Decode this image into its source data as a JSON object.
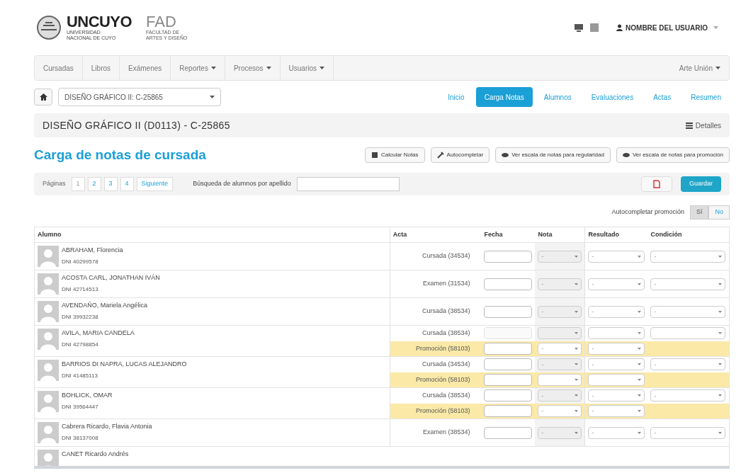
{
  "header": {
    "logo": {
      "name": "UNCUYO",
      "subtitle": "UNIVERSIDAD NACIONAL DE CUYO"
    },
    "faculty": {
      "name": "FAD",
      "subtitle": "FACULTAD DE ARTES Y DISEÑO"
    },
    "user": "NOMBRE DEL USUARIO"
  },
  "nav": {
    "items": [
      {
        "label": "Cursadas",
        "dropdown": false
      },
      {
        "label": "Libros",
        "dropdown": false
      },
      {
        "label": "Exámenes",
        "dropdown": false
      },
      {
        "label": "Reportes",
        "dropdown": true
      },
      {
        "label": "Procesos",
        "dropdown": true
      },
      {
        "label": "Usuarios",
        "dropdown": true
      }
    ],
    "right": {
      "label": "Arte Unión",
      "dropdown": true
    }
  },
  "course_select": {
    "value": "DISEÑO GRÁFICO II: C-25865"
  },
  "tabs": [
    {
      "label": "Inicio",
      "selected": false
    },
    {
      "label": "Carga Notas",
      "selected": true
    },
    {
      "label": "Alumnos",
      "selected": false
    },
    {
      "label": "Evaluaciones",
      "selected": false
    },
    {
      "label": "Actas",
      "selected": false
    },
    {
      "label": "Resumen",
      "selected": false
    }
  ],
  "course_title": "DISEÑO GRÁFICO II (D0113) - C-25865",
  "details_link": "Detalles",
  "page_title": "Carga de notas de cursada",
  "actions": [
    "Calcular Notas",
    "Autocompletar",
    "Ver escala de notas para regularidad",
    "Ver escala de notas para promoción"
  ],
  "pagination": {
    "label": "Páginas",
    "pages": [
      {
        "label": "1",
        "selected": true
      },
      {
        "label": "2",
        "selected": false
      },
      {
        "label": "3",
        "selected": false
      },
      {
        "label": "4",
        "selected": false
      }
    ],
    "next": "Siguiente"
  },
  "search": {
    "label": "Búsqueda de alumnos por apellido"
  },
  "save_button": "Guardar",
  "autocomplete": {
    "label": "Autocompletar promoción",
    "options": [
      {
        "label": "Sí",
        "selected": true
      },
      {
        "label": "No",
        "selected": false
      }
    ]
  },
  "table": {
    "columns": [
      "Alumno",
      "Acta",
      "Fecha",
      "Nota",
      "Resultado",
      "Condición"
    ],
    "rows": [
      {
        "name": "ABRAHAM, Florencia",
        "id": "DNI 40299578",
        "actas": [
          {
            "kind": "cursada",
            "label": "Cursada (34534)",
            "disabled": false,
            "nota": "-",
            "resultado": "-",
            "condicion": "-"
          }
        ]
      },
      {
        "name": "ACOSTA CARL, JONATHAN IVÁN",
        "id": "DNI 42714513",
        "actas": [
          {
            "kind": "cursada",
            "label": "Examen (31534)",
            "disabled": false,
            "nota": "-",
            "resultado": "-",
            "condicion": "-"
          }
        ]
      },
      {
        "name": "AVENDAÑO, Mariela Angélica",
        "id": "DNI 39932238",
        "actas": [
          {
            "kind": "cursada",
            "label": "Cursada (38534)",
            "disabled": false,
            "nota": "-",
            "resultado": "-",
            "condicion": "-"
          }
        ]
      },
      {
        "name": "AVILA, MARIA CANDELA",
        "id": "DNI 42798854",
        "actas": [
          {
            "kind": "cursada",
            "label": "Cursada (38534)",
            "disabled": true
          },
          {
            "kind": "promocion",
            "label": "Promoción (58103)",
            "disabled": false,
            "nota": "-",
            "resultado": "-"
          }
        ]
      },
      {
        "name": "BARRIOS DI NAPRA, LUCAS ALEJANDRO",
        "id": "DNI 41485113",
        "actas": [
          {
            "kind": "cursada",
            "label": "Cursada (34534)",
            "disabled": false,
            "nota": "-",
            "resultado": "-",
            "condicion": "-"
          },
          {
            "kind": "promocion",
            "label": "Promoción (58103)",
            "disabled": false
          }
        ]
      },
      {
        "name": "BOHLICK, OMAR",
        "id": "DNI 39564447",
        "actas": [
          {
            "kind": "cursada",
            "label": "Cursada (38534)",
            "disabled": false,
            "nota": "-",
            "resultado": "-",
            "condicion": "-"
          },
          {
            "kind": "promocion",
            "label": "Promoción (58103)",
            "disabled": false,
            "nota": "-",
            "resultado": "-"
          }
        ]
      },
      {
        "name": "Cabrera Ricardo, Flavia Antonia",
        "id": "DNI 38137008",
        "actas": [
          {
            "kind": "cursada",
            "label": "Examen (38534)",
            "disabled": false,
            "nota": "-",
            "resultado": "-",
            "condicion": "-"
          }
        ]
      },
      {
        "name": "CANET Ricardo Andrés",
        "actas": []
      }
    ]
  }
}
